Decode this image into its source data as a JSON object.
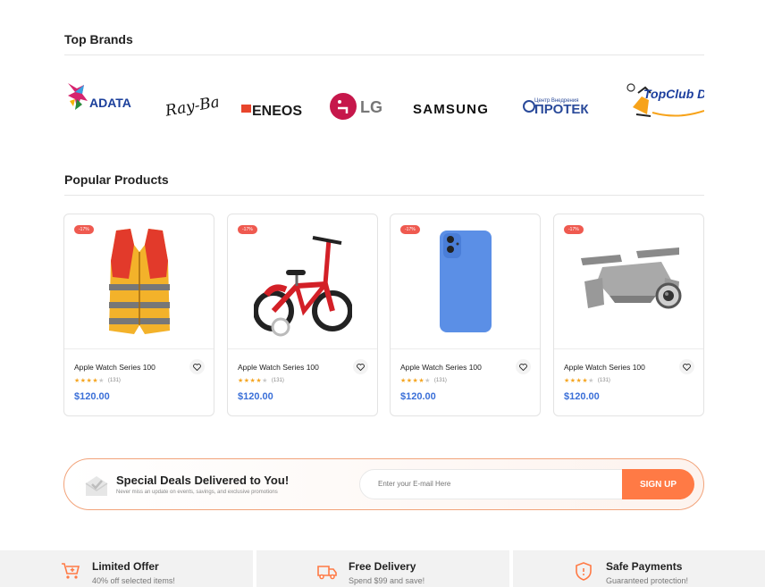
{
  "top_brands": {
    "title": "Top Brands",
    "items": [
      {
        "name": "ADATA",
        "icon": "adata-logo"
      },
      {
        "name": "Ray-Ban",
        "icon": "rayban-logo"
      },
      {
        "name": "ENEOS",
        "icon": "eneos-logo"
      },
      {
        "name": "LG",
        "icon": "lg-logo"
      },
      {
        "name": "SAMSUNG",
        "icon": "samsung-logo"
      },
      {
        "name": "ПРОТЕК",
        "tagline": "Центр Внедрения",
        "icon": "protek-logo"
      },
      {
        "name": "TopClub Deals",
        "icon": "topclub-logo"
      }
    ]
  },
  "popular_products": {
    "title": "Popular Products",
    "items": [
      {
        "badge": "-17%",
        "name": "Apple Watch Series 100",
        "rating": 4,
        "reviews": "(131)",
        "price": "$120.00",
        "image": "life-jacket"
      },
      {
        "badge": "-17%",
        "name": "Apple Watch Series 100",
        "rating": 4,
        "reviews": "(131)",
        "price": "$120.00",
        "image": "kids-bicycle"
      },
      {
        "badge": "-17%",
        "name": "Apple Watch Series 100",
        "rating": 4,
        "reviews": "(131)",
        "price": "$120.00",
        "image": "blue-smartphone"
      },
      {
        "badge": "-17%",
        "name": "Apple Watch Series 100",
        "rating": 4,
        "reviews": "(131)",
        "price": "$120.00",
        "image": "drone"
      }
    ]
  },
  "newsletter": {
    "title": "Special Deals Delivered to You!",
    "subtitle": "Never miss an update on events, savings, and exclusive promotions",
    "email_placeholder": "Enter your E-mail Here",
    "button_label": "SIGN UP"
  },
  "features": [
    {
      "title": "Limited Offer",
      "subtitle": "40% off selected items!",
      "icon": "cart-plus-icon"
    },
    {
      "title": "Free Delivery",
      "subtitle": "Spend $99 and save!",
      "icon": "truck-icon"
    },
    {
      "title": "Safe Payments",
      "subtitle": "Guaranteed protection!",
      "icon": "shield-icon"
    }
  ],
  "colors": {
    "accent": "#ff7a45",
    "price": "#3a6fd8",
    "badge": "#ef5a50",
    "star": "#f5a623"
  }
}
